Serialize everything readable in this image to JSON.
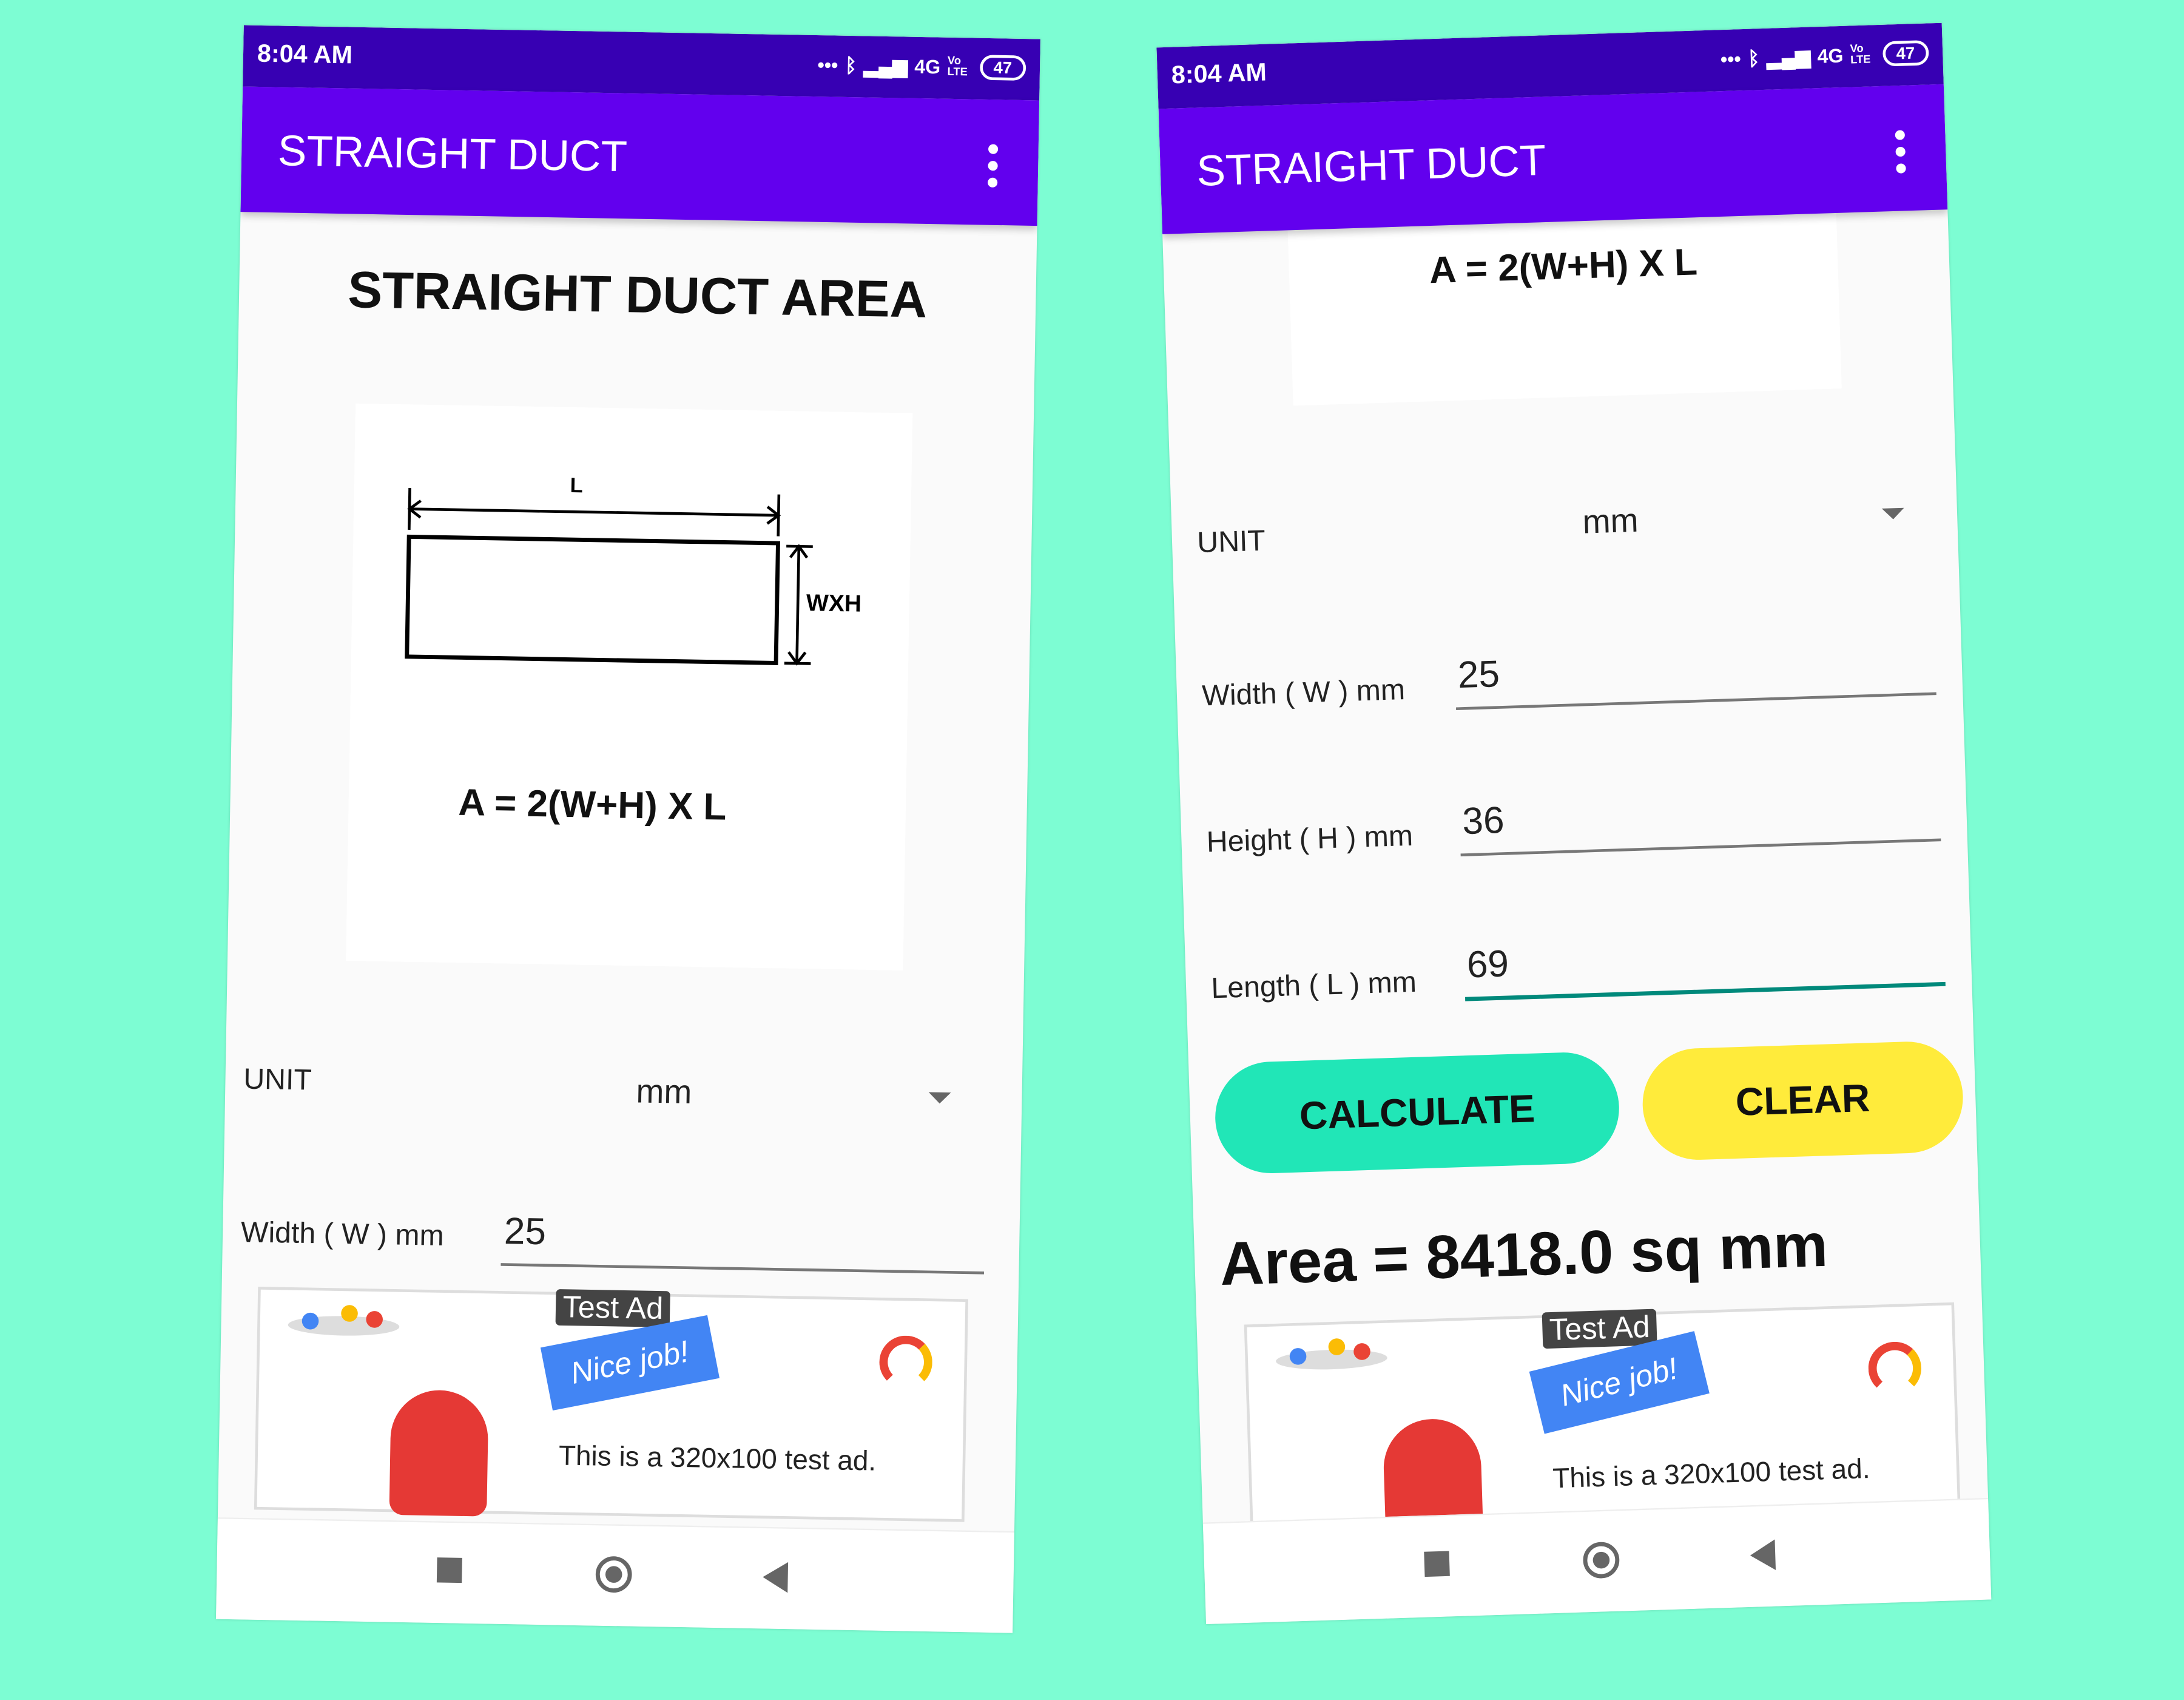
{
  "colors": {
    "background": "#7dfdd3",
    "status_bar": "#3700b3",
    "app_bar": "#6200ee",
    "calculate": "#21e6b7",
    "clear": "#ffeb3b",
    "focus_underline": "#00897b"
  },
  "status": {
    "time": "8:04 AM",
    "network": "4G",
    "volte": "Vo LTE",
    "battery": "47"
  },
  "app": {
    "title": "STRAIGHT DUCT",
    "menu_icon": "more-vert-icon"
  },
  "phones": [
    {
      "heading": "STRAIGHT DUCT AREA",
      "diagram": {
        "length_label": "L",
        "cross_label": "WXH"
      },
      "formula": "A = 2(W+H) X L",
      "unit": {
        "label": "UNIT",
        "value": "mm"
      },
      "width": {
        "label": "Width ( W ) mm",
        "value": "25"
      }
    },
    {
      "formula": "A = 2(W+H) X L",
      "unit": {
        "label": "UNIT",
        "value": "mm"
      },
      "width": {
        "label": "Width ( W ) mm",
        "value": "25"
      },
      "height": {
        "label": "Height ( H ) mm",
        "value": "36"
      },
      "length": {
        "label": "Length ( L ) mm",
        "value": "69"
      },
      "calculate_label": "CALCULATE",
      "clear_label": "CLEAR",
      "result": "Area = 8418.0 sq mm"
    }
  ],
  "ad": {
    "badge": "Test Ad",
    "flag": "Nice job!",
    "text": "This is a 320x100 test ad."
  }
}
